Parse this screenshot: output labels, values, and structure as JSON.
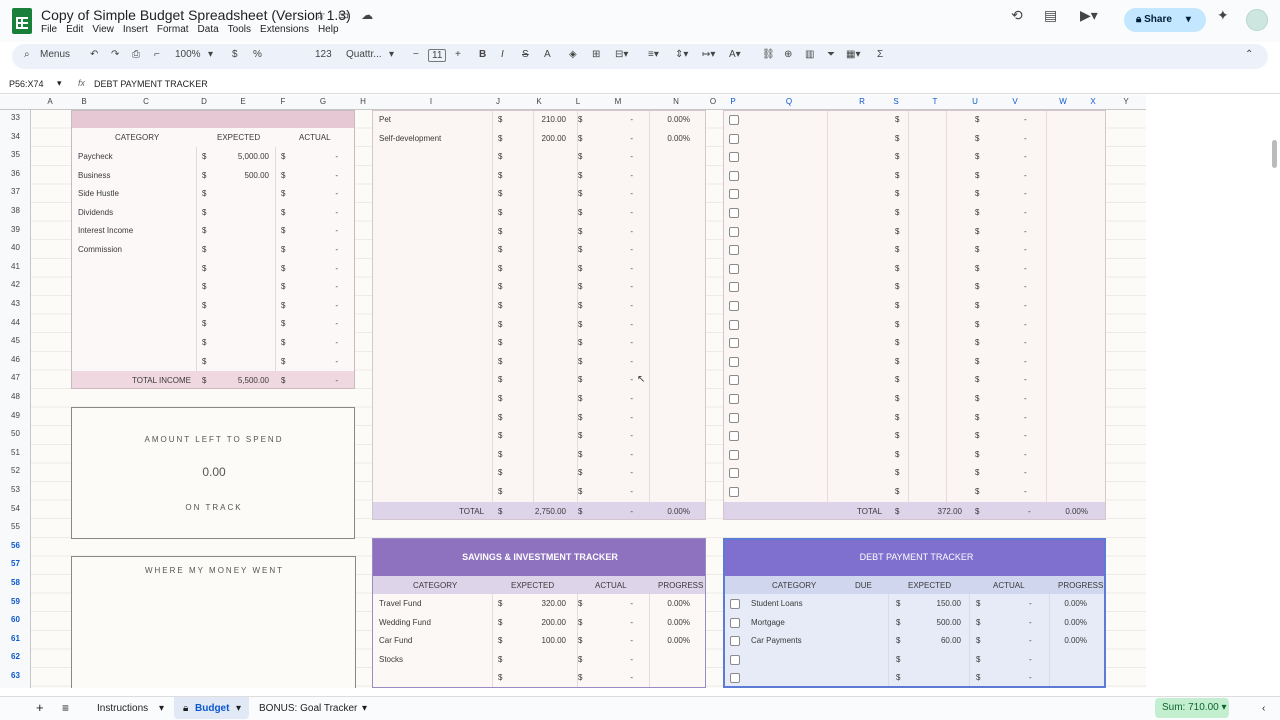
{
  "app": {
    "title": "Copy of Simple Budget Spreadsheet (Version 1.3)",
    "menus": [
      "File",
      "Edit",
      "View",
      "Insert",
      "Format",
      "Data",
      "Tools",
      "Extensions",
      "Help"
    ],
    "share_label": "Share"
  },
  "toolbar": {
    "search_label": "Menus",
    "zoom": "100%",
    "currency": "$",
    "percent": "%",
    "number_format": "123",
    "font": "Quattr...",
    "font_size": "11"
  },
  "formula": {
    "cell_ref": "P56:X74",
    "fx": "fx",
    "content": "DEBT PAYMENT TRACKER"
  },
  "columns": [
    "A",
    "B",
    "C",
    "D",
    "E",
    "F",
    "G",
    "H",
    "I",
    "J",
    "K",
    "L",
    "M",
    "N",
    "O",
    "P",
    "Q",
    "R",
    "S",
    "T",
    "U",
    "V",
    "W",
    "X",
    "Y"
  ],
  "rows": [
    "33",
    "34",
    "35",
    "36",
    "37",
    "38",
    "39",
    "40",
    "41",
    "42",
    "43",
    "44",
    "45",
    "46",
    "47",
    "48",
    "49",
    "50",
    "51",
    "52",
    "53",
    "54",
    "55",
    "56",
    "57",
    "58",
    "59",
    "60",
    "61",
    "62",
    "63"
  ],
  "income": {
    "headers": [
      "CATEGORY",
      "EXPECTED",
      "ACTUAL"
    ],
    "items": [
      [
        "Paycheck",
        "5,000.00",
        "-"
      ],
      [
        "Business",
        "500.00",
        "-"
      ],
      [
        "Side Hustle",
        "",
        "-"
      ],
      [
        "Dividends",
        "",
        "-"
      ],
      [
        "Interest Income",
        "",
        "-"
      ],
      [
        "Commission",
        "",
        "-"
      ],
      [
        "",
        "",
        "-"
      ],
      [
        "",
        "",
        "-"
      ],
      [
        "",
        "",
        "-"
      ],
      [
        "",
        "",
        "-"
      ],
      [
        "",
        "",
        "-"
      ],
      [
        "",
        "",
        "-"
      ]
    ],
    "total_label": "TOTAL INCOME",
    "total_expected": "5,500.00",
    "total_actual": "-",
    "currency": "$"
  },
  "left_to_spend": {
    "title": "AMOUNT LEFT TO SPEND",
    "value": "0.00",
    "status": "ON TRACK"
  },
  "money_went": {
    "title": "WHERE MY MONEY WENT"
  },
  "expenses": {
    "items": [
      [
        "Pet",
        "210.00",
        "-",
        "0.00%"
      ],
      [
        "Self-development",
        "200.00",
        "-",
        "0.00%"
      ],
      [
        "",
        "",
        "-",
        ""
      ],
      [
        "",
        "",
        "-",
        ""
      ],
      [
        "",
        "",
        "-",
        ""
      ],
      [
        "",
        "",
        "-",
        ""
      ],
      [
        "",
        "",
        "-",
        ""
      ],
      [
        "",
        "",
        "-",
        ""
      ],
      [
        "",
        "",
        "-",
        ""
      ],
      [
        "",
        "",
        "-",
        ""
      ],
      [
        "",
        "",
        "-",
        ""
      ],
      [
        "",
        "",
        "-",
        ""
      ],
      [
        "",
        "",
        "-",
        ""
      ],
      [
        "",
        "",
        "-",
        ""
      ],
      [
        "",
        "",
        "-",
        ""
      ],
      [
        "",
        "",
        "-",
        ""
      ],
      [
        "",
        "",
        "-",
        ""
      ],
      [
        "",
        "",
        "-",
        ""
      ],
      [
        "",
        "",
        "-",
        ""
      ],
      [
        "",
        "",
        "-",
        ""
      ],
      [
        "",
        "",
        "-",
        ""
      ]
    ],
    "total_label": "TOTAL",
    "total_expected": "2,750.00",
    "total_actual": "-",
    "total_progress": "0.00%",
    "currency": "$"
  },
  "savings": {
    "title": "SAVINGS & INVESTMENT TRACKER",
    "headers": [
      "CATEGORY",
      "EXPECTED",
      "ACTUAL",
      "PROGRESS"
    ],
    "items": [
      [
        "Travel Fund",
        "320.00",
        "-",
        "0.00%"
      ],
      [
        "Wedding Fund",
        "200.00",
        "-",
        "0.00%"
      ],
      [
        "Car Fund",
        "100.00",
        "-",
        "0.00%"
      ],
      [
        "Stocks",
        "",
        "-",
        ""
      ],
      [
        "",
        "",
        "-",
        ""
      ]
    ],
    "currency": "$"
  },
  "bills": {
    "rows": 21,
    "total_label": "TOTAL",
    "total_expected": "372.00",
    "total_actual": "-",
    "total_progress": "0.00%",
    "currency": "$"
  },
  "debt": {
    "title": "DEBT PAYMENT TRACKER",
    "headers": [
      "CATEGORY",
      "DUE",
      "EXPECTED",
      "ACTUAL",
      "PROGRESS"
    ],
    "items": [
      [
        "Student Loans",
        "150.00",
        "-",
        "0.00%"
      ],
      [
        "Mortgage",
        "500.00",
        "-",
        "0.00%"
      ],
      [
        "Car Payments",
        "60.00",
        "-",
        "0.00%"
      ],
      [
        "",
        "",
        "-",
        ""
      ],
      [
        "",
        "",
        "-",
        ""
      ]
    ],
    "currency": "$"
  },
  "sheet_tabs": [
    "Instructions",
    "Budget",
    "BONUS: Goal Tracker"
  ],
  "sum": "Sum: 710.00",
  "colors": {
    "income_header": "#e6c8d4",
    "income_total": "#f0d8e1",
    "savings_header": "#8e72bf",
    "debt_header": "#7f6fcf",
    "bills_total": "#ddd4e9",
    "debt_body": "#e6ebf7"
  }
}
